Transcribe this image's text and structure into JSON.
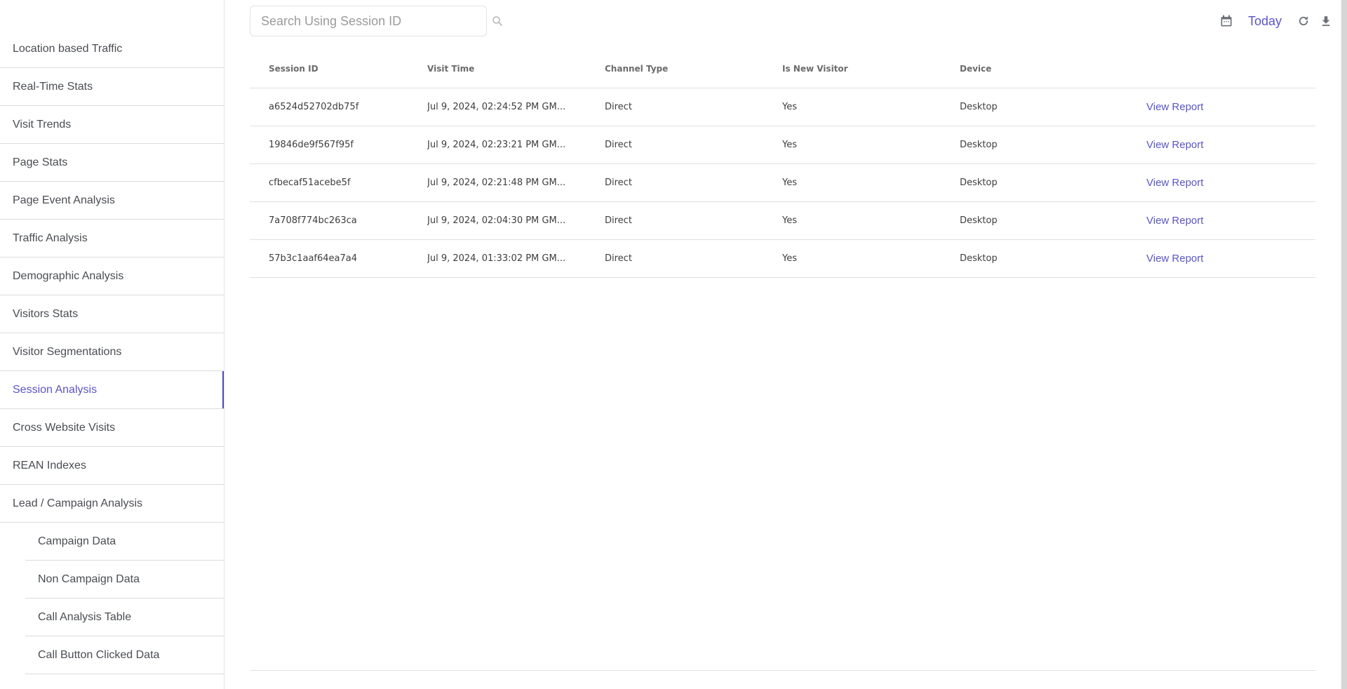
{
  "sidebar": {
    "items": [
      {
        "label": "Location based Traffic",
        "sub": false,
        "active": false
      },
      {
        "label": "Real-Time Stats",
        "sub": false,
        "active": false
      },
      {
        "label": "Visit Trends",
        "sub": false,
        "active": false
      },
      {
        "label": "Page Stats",
        "sub": false,
        "active": false
      },
      {
        "label": "Page Event Analysis",
        "sub": false,
        "active": false
      },
      {
        "label": "Traffic Analysis",
        "sub": false,
        "active": false
      },
      {
        "label": "Demographic Analysis",
        "sub": false,
        "active": false
      },
      {
        "label": "Visitors Stats",
        "sub": false,
        "active": false
      },
      {
        "label": "Visitor Segmentations",
        "sub": false,
        "active": false
      },
      {
        "label": "Session Analysis",
        "sub": false,
        "active": true
      },
      {
        "label": "Cross Website Visits",
        "sub": false,
        "active": false
      },
      {
        "label": "REAN Indexes",
        "sub": false,
        "active": false
      },
      {
        "label": "Lead / Campaign Analysis",
        "sub": false,
        "active": false
      },
      {
        "label": "Campaign Data",
        "sub": true,
        "active": false
      },
      {
        "label": "Non Campaign Data",
        "sub": true,
        "active": false
      },
      {
        "label": "Call Analysis Table",
        "sub": true,
        "active": false
      },
      {
        "label": "Call Button Clicked Data",
        "sub": true,
        "active": false
      }
    ]
  },
  "toolbar": {
    "search_placeholder": "Search Using Session ID",
    "search_value": "",
    "date_range_label": "Today",
    "icons": [
      "search-icon",
      "calendar-icon",
      "refresh-icon",
      "download-icon"
    ]
  },
  "table": {
    "columns": [
      "Session ID",
      "Visit Time",
      "Channel Type",
      "Is New Visitor",
      "Device",
      ""
    ],
    "rows": [
      {
        "session_id": "a6524d52702db75f",
        "visit_time": "Jul 9, 2024, 02:24:52 PM GM...",
        "channel_type": "Direct",
        "is_new_visitor": "Yes",
        "device": "Desktop",
        "action": "View Report"
      },
      {
        "session_id": "19846de9f567f95f",
        "visit_time": "Jul 9, 2024, 02:23:21 PM GM...",
        "channel_type": "Direct",
        "is_new_visitor": "Yes",
        "device": "Desktop",
        "action": "View Report"
      },
      {
        "session_id": "cfbecaf51acebe5f",
        "visit_time": "Jul 9, 2024, 02:21:48 PM GM...",
        "channel_type": "Direct",
        "is_new_visitor": "Yes",
        "device": "Desktop",
        "action": "View Report"
      },
      {
        "session_id": "7a708f774bc263ca",
        "visit_time": "Jul 9, 2024, 02:04:30 PM GM...",
        "channel_type": "Direct",
        "is_new_visitor": "Yes",
        "device": "Desktop",
        "action": "View Report"
      },
      {
        "session_id": "57b3c1aaf64ea7a4",
        "visit_time": "Jul 9, 2024, 01:33:02 PM GM...",
        "channel_type": "Direct",
        "is_new_visitor": "Yes",
        "device": "Desktop",
        "action": "View Report"
      }
    ]
  },
  "colors": {
    "accent": "#5a55c8",
    "active_bar": "#4e4ab8",
    "text": "#3d3d3d",
    "border": "#e0e0e0"
  }
}
